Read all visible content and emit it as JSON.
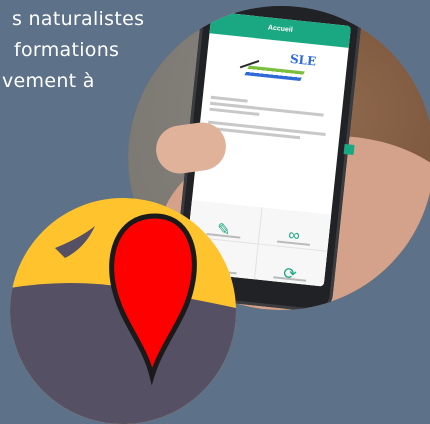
{
  "slide": {
    "lines": [
      "s naturalistes",
      "formations",
      "vement  à"
    ]
  },
  "phone_app": {
    "title": "Accueil",
    "logo_text": "SLE",
    "tiles": [
      {
        "name": "tile-saisir",
        "icon": "edit-icon"
      },
      {
        "name": "tile-consulter",
        "icon": "binoculars-icon"
      },
      {
        "name": "tile-options",
        "icon": "gear-icon"
      },
      {
        "name": "tile-synchroniser",
        "icon": "sync-icon"
      }
    ]
  },
  "colors": {
    "background": "#5d7289",
    "app_accent": "#1aa883",
    "logo_yellow": "#ffc42d",
    "logo_gray": "#555064",
    "pin_red": "#ff0000"
  }
}
